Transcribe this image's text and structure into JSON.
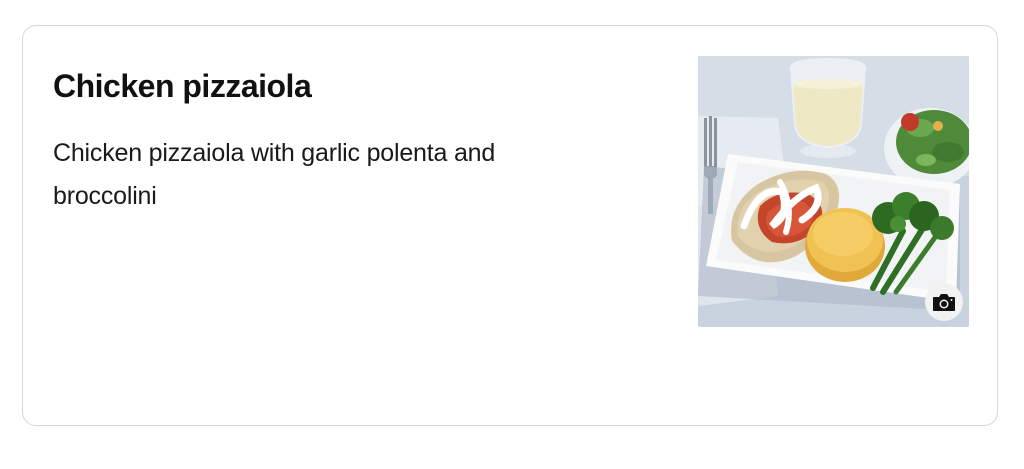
{
  "meal": {
    "title": "Chicken pizzaiola",
    "description": "Chicken pizzaiola with garlic polenta and broccolini"
  },
  "photo": {
    "subject": "meal-photo",
    "camera_icon": "camera-icon"
  },
  "colors": {
    "border": "#d6d6d6",
    "title_text": "#111111",
    "body_text": "#1a1a1a"
  }
}
